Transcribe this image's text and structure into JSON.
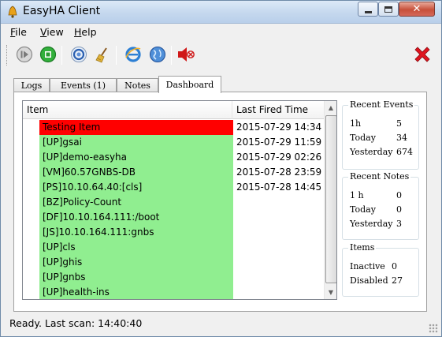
{
  "window": {
    "title": "EasyHA Client",
    "icon": "bell-icon",
    "controls": {
      "minimize": "minimize-icon",
      "maximize": "maximize-icon",
      "close": "close-icon",
      "close_glyph": "✕"
    }
  },
  "menu": {
    "file": "File",
    "view": "View",
    "help": "Help"
  },
  "toolbar": {
    "buttons": [
      {
        "name": "start-icon",
        "color": "#8a8a8a"
      },
      {
        "name": "stop-icon",
        "color": "#1f9a2a"
      },
      {
        "name": "refresh-icon",
        "color": "#2a5fb0"
      },
      {
        "name": "broom-icon",
        "color": "#c99a2e"
      },
      {
        "name": "internet-explorer-icon",
        "color": "#2c7fd4"
      },
      {
        "name": "globe-icon",
        "color": "#2f6fb8"
      },
      {
        "name": "speaker-mute-icon",
        "color": "#d01818"
      },
      {
        "name": "exit-x-icon",
        "color": "#e0141e"
      }
    ]
  },
  "tabs": [
    {
      "label": "Logs",
      "active": false
    },
    {
      "label": "Events (1)",
      "active": false
    },
    {
      "label": "Notes",
      "active": false
    },
    {
      "label": "Dashboard",
      "active": true
    }
  ],
  "list": {
    "columns": {
      "item": "Item",
      "last_fired": "Last Fired Time"
    },
    "rows": [
      {
        "item": "Testing Item",
        "time": "2015-07-29 14:34",
        "color": "#ff0000"
      },
      {
        "item": "[UP]gsai",
        "time": "2015-07-29 11:59",
        "color": "#90ee90"
      },
      {
        "item": "[UP]demo-easyha",
        "time": "2015-07-29 02:26",
        "color": "#90ee90"
      },
      {
        "item": "[VM]60.57GNBS-DB",
        "time": "2015-07-28 23:59",
        "color": "#90ee90"
      },
      {
        "item": "[PS]10.10.64.40:[cls]",
        "time": "2015-07-28 14:45",
        "color": "#90ee90"
      },
      {
        "item": "[BZ]Policy-Count",
        "time": "",
        "color": "#90ee90"
      },
      {
        "item": "[DF]10.10.164.111:/boot",
        "time": "",
        "color": "#90ee90"
      },
      {
        "item": "[JS]10.10.164.111:gnbs",
        "time": "",
        "color": "#90ee90"
      },
      {
        "item": "[UP]cls",
        "time": "",
        "color": "#90ee90"
      },
      {
        "item": "[UP]ghis",
        "time": "",
        "color": "#90ee90"
      },
      {
        "item": "[UP]gnbs",
        "time": "",
        "color": "#90ee90"
      },
      {
        "item": "[UP]health-ins",
        "time": "",
        "color": "#90ee90"
      }
    ]
  },
  "recent_events": {
    "title": "Recent Events",
    "rows": [
      {
        "label": "1h",
        "value": "5"
      },
      {
        "label": "Today",
        "value": "34"
      },
      {
        "label": "Yesterday",
        "value": "674"
      }
    ]
  },
  "recent_notes": {
    "title": "Recent Notes",
    "rows": [
      {
        "label": "1 h",
        "value": "0"
      },
      {
        "label": "Today",
        "value": "0"
      },
      {
        "label": "Yesterday",
        "value": "3"
      }
    ]
  },
  "items": {
    "title": "Items",
    "rows": [
      {
        "label": "Inactive",
        "value": "0"
      },
      {
        "label": "Disabled",
        "value": "27"
      }
    ]
  },
  "status": {
    "text": "Ready. Last scan: 14:40:40"
  }
}
